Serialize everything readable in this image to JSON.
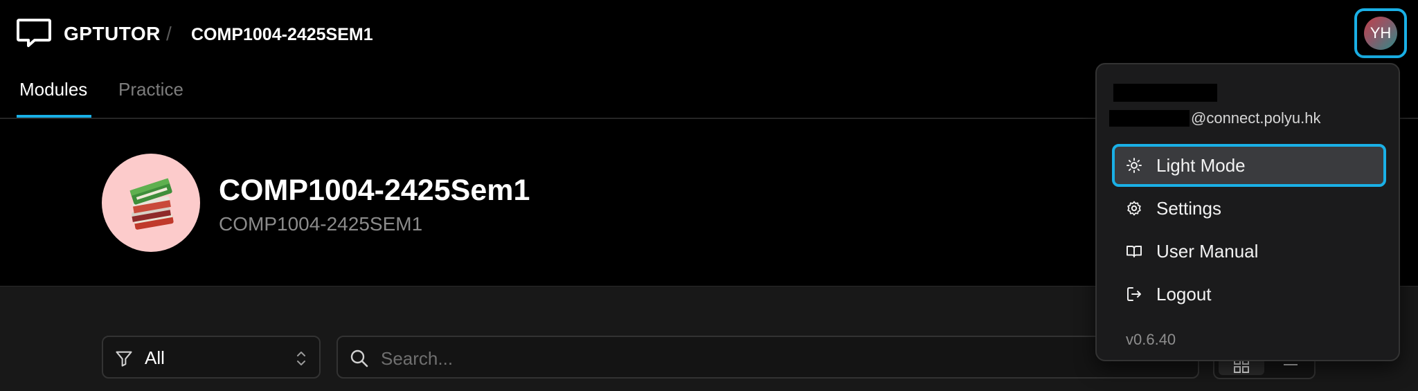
{
  "header": {
    "brand": "GPTUTOR",
    "separator": "/",
    "breadcrumb": "COMP1004-2425SEM1",
    "avatar_initials": "YH"
  },
  "tabs": [
    {
      "label": "Modules",
      "active": true
    },
    {
      "label": "Practice",
      "active": false
    }
  ],
  "course": {
    "icon": "books-icon",
    "title": "COMP1004-2425Sem1",
    "subtitle": "COMP1004-2425SEM1"
  },
  "toolbar": {
    "filter_value": "All",
    "search_placeholder": "Search..."
  },
  "user_menu": {
    "email_domain": "@connect.polyu.hk",
    "items": [
      {
        "label": "Light Mode",
        "icon": "sun-icon",
        "highlighted": true
      },
      {
        "label": "Settings",
        "icon": "gear-icon",
        "highlighted": false
      },
      {
        "label": "User Manual",
        "icon": "book-open-icon",
        "highlighted": false
      },
      {
        "label": "Logout",
        "icon": "logout-icon",
        "highlighted": false
      }
    ],
    "version": "v0.6.40"
  },
  "colors": {
    "accent": "#1ab0e6",
    "background": "#000000",
    "panel": "#181818",
    "menu_bg": "#1b1b1c",
    "course_avatar_bg": "#fccbcb"
  }
}
